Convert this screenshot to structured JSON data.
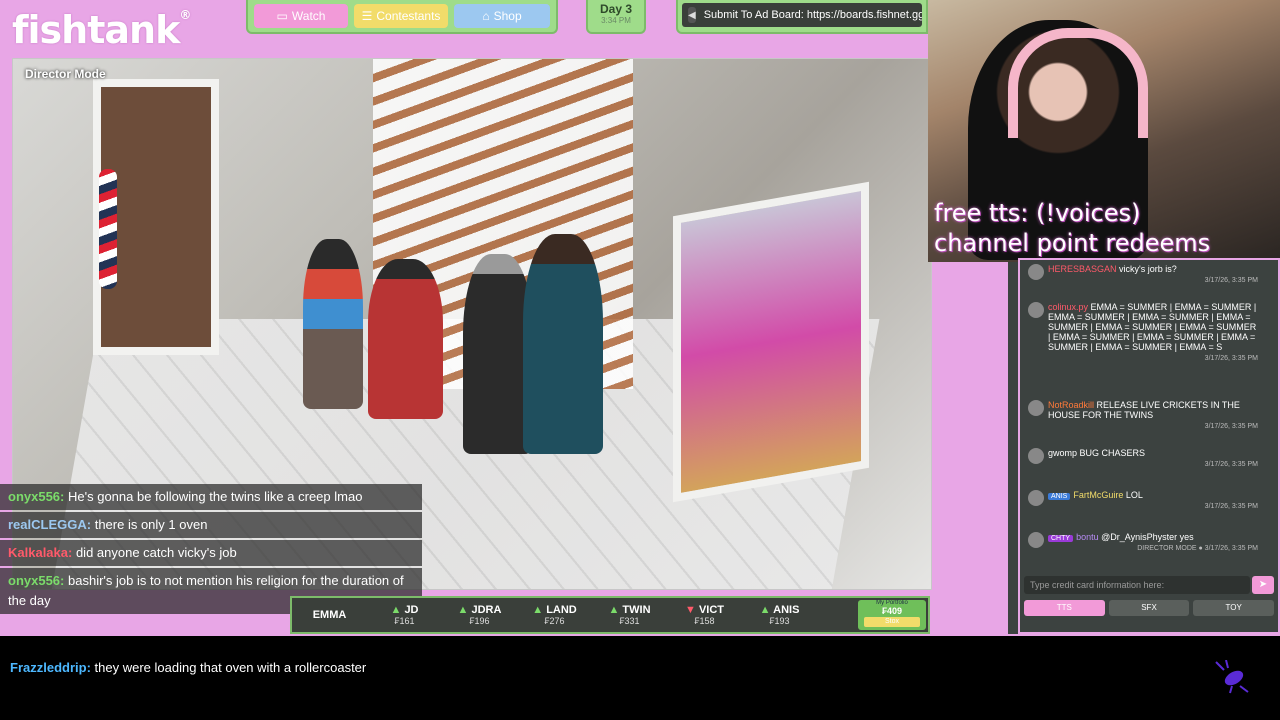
{
  "logo": {
    "text": "fishtank",
    "mark": "®"
  },
  "nav": {
    "watch": "Watch",
    "contestants": "Contestants",
    "shop": "Shop"
  },
  "day": {
    "label": "Day 3",
    "time": "3:34 PM"
  },
  "adboard": {
    "text": "Submit To Ad Board: https://boards.fishnet.gg"
  },
  "video": {
    "mode_label": "Director Mode"
  },
  "overlay_chat": [
    {
      "user": "onyx556:",
      "text": "He's gonna be following the twins like a creep lmao",
      "color": "#7bdc6a"
    },
    {
      "user": "realCLEGGA:",
      "text": "there is only 1 oven",
      "color": "#9cc8f0"
    },
    {
      "user": "Kalkalaka:",
      "text": "did anyone catch vicky's job",
      "color": "#ff5a6a"
    },
    {
      "user": "onyx556:",
      "text": "bashir's job is to not mention his religion for the duration of the day",
      "color": "#7bdc6a"
    }
  ],
  "ticker": {
    "items": [
      {
        "name": "EMMA",
        "price": "",
        "dir": ""
      },
      {
        "name": "JD",
        "price": "₣161",
        "dir": "up"
      },
      {
        "name": "JDRA",
        "price": "₣196",
        "dir": "up"
      },
      {
        "name": "LAND",
        "price": "₣276",
        "dir": "up"
      },
      {
        "name": "TWIN",
        "price": "₣331",
        "dir": "up"
      },
      {
        "name": "VICT",
        "price": "₣158",
        "dir": "down"
      },
      {
        "name": "ANIS",
        "price": "₣193",
        "dir": "up"
      }
    ],
    "portfolio_title": "My Portfolio",
    "portfolio_value": "₣409",
    "portfolio_button": "Stox"
  },
  "webcam": {
    "overlay_line1": "free tts: (!voices)",
    "overlay_line2": "channel point redeems"
  },
  "side_chat": {
    "messages": [
      {
        "user": "HERESBASGAN",
        "text": "vicky's jorb is?",
        "time": ""
      },
      {
        "user": "colinux.py",
        "text": "EMMA = SUMMER | EMMA = SUMMER | EMMA = SUMMER | EMMA = SUMMER | EMMA = SUMMER | EMMA = SUMMER | EMMA = SUMMER | EMMA = SUMMER | EMMA = SUMMER | EMMA = SUMMER | EMMA = SUMMER | EMMA = S",
        "time": "3/17/26, 3:35 PM"
      },
      {
        "user": "NotRoadkill",
        "text": "RELEASE LIVE CRICKETS IN THE HOUSE FOR THE TWINS",
        "time": "3/17/26, 3:35 PM"
      },
      {
        "user": "gwomp",
        "text": "BUG CHASERS",
        "time": "3/17/26, 3:35 PM"
      },
      {
        "user": "FartMcGuire",
        "badge": "ANIS",
        "text": "LOL",
        "time": "3/17/26, 3:35 PM"
      },
      {
        "user": "bontu",
        "badge": "CHTY",
        "text": "@Dr_AynisPhyster yes",
        "time": "DIRECTOR MODE ● 3/17/26, 3:35 PM"
      }
    ],
    "first_time": "3/17/26, 3:35 PM",
    "input_placeholder": "Type credit card information here:",
    "tabs": [
      "TTS",
      "SFX",
      "TOY"
    ]
  },
  "bottom_chat": {
    "user": "Frazzleddrip:",
    "text": "they were loading that oven with a rollercoaster"
  },
  "volume_level": 0.4
}
